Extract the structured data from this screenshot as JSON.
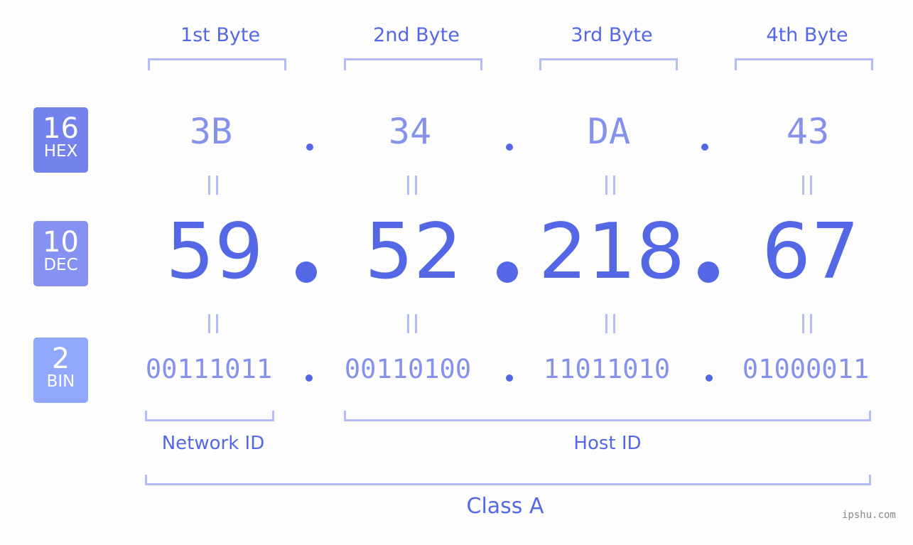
{
  "byte_headers": [
    "1st Byte",
    "2nd Byte",
    "3rd Byte",
    "4th Byte"
  ],
  "badges": {
    "hex": {
      "base": "16",
      "label": "HEX",
      "color": "#7482ec"
    },
    "dec": {
      "base": "10",
      "label": "DEC",
      "color": "#8592f2"
    },
    "bin": {
      "base": "2",
      "label": "BIN",
      "color": "#90a7fa"
    }
  },
  "hex": [
    "3B",
    "34",
    "DA",
    "43"
  ],
  "dec": [
    "59",
    "52",
    "218",
    "67"
  ],
  "bin": [
    "00111011",
    "00110100",
    "11011010",
    "01000011"
  ],
  "network_id_label": "Network ID",
  "host_id_label": "Host ID",
  "class_label": "Class A",
  "watermark": "ipshu.com",
  "colors": {
    "accent": "#5468e6",
    "light_value": "#8592ec",
    "bracket": "#b3bcf7",
    "background": "#fcfdfc"
  }
}
